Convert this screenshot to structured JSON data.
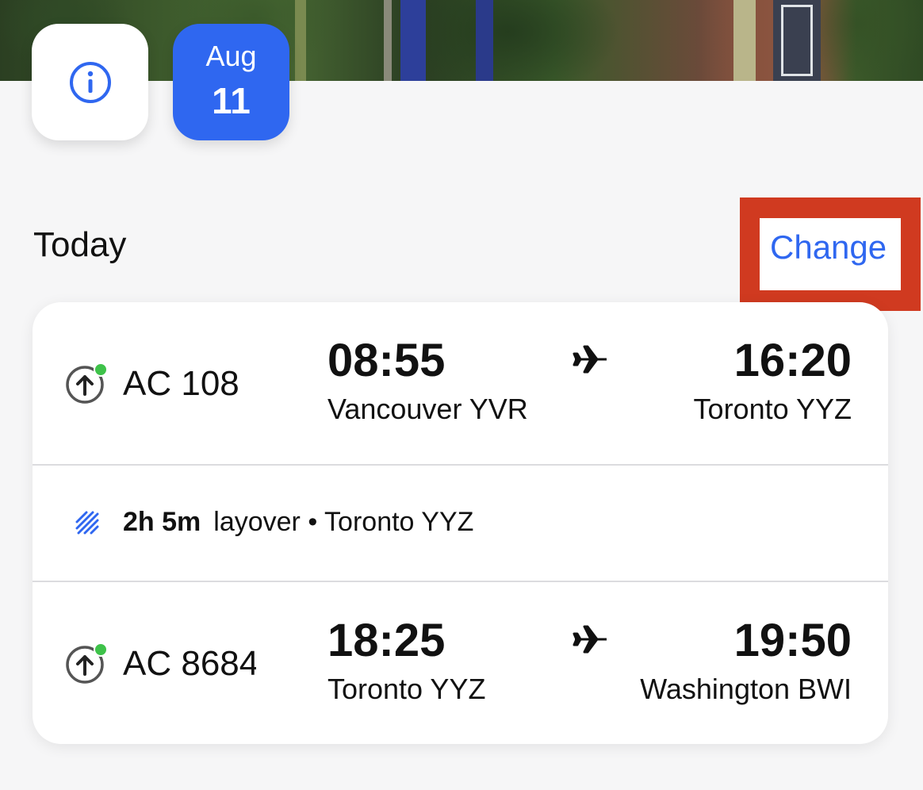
{
  "header": {
    "date_chip": {
      "month": "Aug",
      "day": "11"
    }
  },
  "section": {
    "title": "Today",
    "change_label": "Change"
  },
  "itinerary": {
    "flights": [
      {
        "flight_number": "AC 108",
        "departure_time": "08:55",
        "departure_city": "Vancouver YVR",
        "arrival_time": "16:20",
        "arrival_city": "Toronto YYZ"
      },
      {
        "flight_number": "AC 8684",
        "departure_time": "18:25",
        "departure_city": "Toronto YYZ",
        "arrival_time": "19:50",
        "arrival_city": "Washington BWI"
      }
    ],
    "layover": {
      "duration": "2h 5m",
      "text": "layover • Toronto YYZ"
    }
  },
  "icons": {
    "info": "info-icon",
    "status": "departure-status-icon",
    "plane": "plane-icon",
    "layover": "layover-hatch-icon"
  },
  "colors": {
    "accent": "#2f67f0",
    "status_dot": "#3ec24a",
    "highlight": "#d03a20"
  }
}
